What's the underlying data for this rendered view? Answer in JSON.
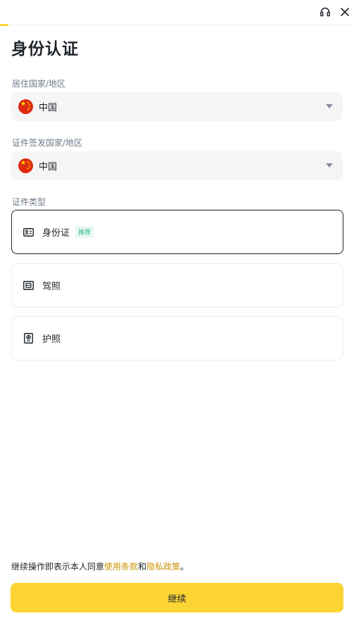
{
  "header": {
    "support_icon": "headset-icon",
    "close_icon": "close-icon",
    "progress_percent": 2
  },
  "page": {
    "title": "身份认证"
  },
  "residence": {
    "label": "居住国家/地区",
    "value": "中国",
    "flag_icon": "china-flag-icon"
  },
  "issuing": {
    "label": "证件签发国家/地区",
    "value": "中国",
    "flag_icon": "china-flag-icon"
  },
  "doc_type": {
    "label": "证件类型",
    "options": [
      {
        "label": "身份证",
        "badge": "推荐",
        "icon": "id-card-icon",
        "selected": true
      },
      {
        "label": "驾照",
        "icon": "driver-license-icon",
        "selected": false
      },
      {
        "label": "护照",
        "icon": "passport-icon",
        "selected": false
      }
    ]
  },
  "footer": {
    "agree_prefix": "继续操作即表示本人同意",
    "terms_link": "使用条款",
    "and": "和",
    "privacy_link": "隐私政策",
    "suffix": "。",
    "continue_label": "继续"
  },
  "colors": {
    "accent": "#fcd535",
    "link": "#c99400",
    "badge": "#2ebd85"
  }
}
